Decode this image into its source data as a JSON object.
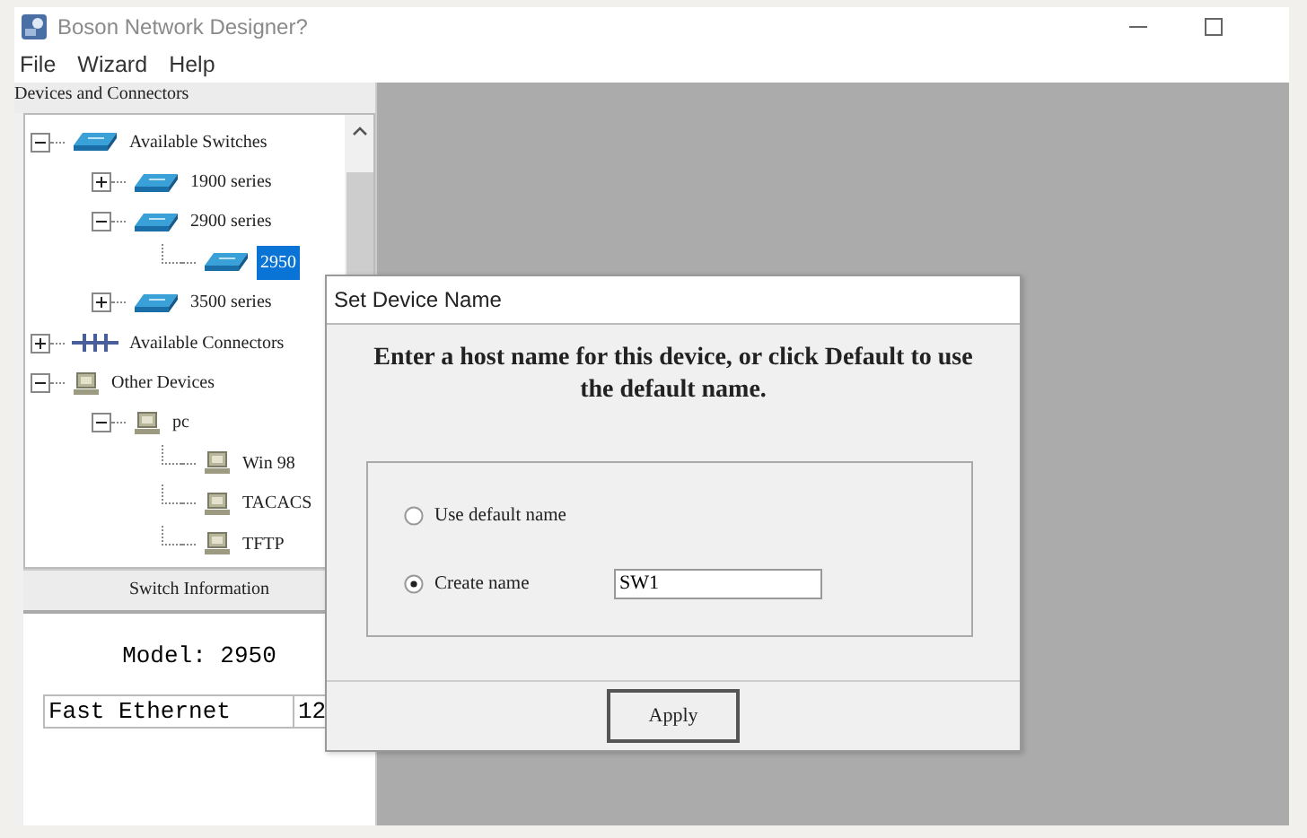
{
  "window": {
    "title": "Boson Network Designer?"
  },
  "menu": [
    "File",
    "Wizard",
    "Help"
  ],
  "devices_panel": {
    "title": "Devices and Connectors",
    "tree": [
      {
        "label": "Available Switches",
        "kind": "switch",
        "expanded": true,
        "selected": false,
        "children": [
          {
            "label": "1900 series",
            "kind": "switch",
            "expanded": false,
            "selected": false
          },
          {
            "label": "2900 series",
            "kind": "switch",
            "expanded": true,
            "selected": false,
            "children": [
              {
                "label": "2950",
                "kind": "switch",
                "selected": true
              }
            ]
          },
          {
            "label": "3500 series",
            "kind": "switch",
            "expanded": false,
            "selected": false
          }
        ]
      },
      {
        "label": "Available Connectors",
        "kind": "connector",
        "expanded": false,
        "selected": false
      },
      {
        "label": "Other Devices",
        "kind": "pc",
        "expanded": true,
        "selected": false,
        "children": [
          {
            "label": "pc",
            "kind": "pc",
            "expanded": true,
            "selected": false,
            "children": [
              {
                "label": "Win 98",
                "kind": "pc",
                "selected": false
              },
              {
                "label": "TACACS",
                "kind": "pc",
                "selected": false
              },
              {
                "label": "TFTP",
                "kind": "pc",
                "selected": false
              }
            ]
          }
        ]
      }
    ]
  },
  "switch_info": {
    "title": "Switch Information",
    "model": "Model: 2950",
    "ports": [
      {
        "name": "Fast Ethernet",
        "count": "12"
      }
    ]
  },
  "dialog": {
    "title": "Set Device Name",
    "prompt": "Enter a host name for this device, or click Default to use the default name.",
    "options": [
      {
        "label": "Use default name",
        "selected": false
      },
      {
        "label": "Create name",
        "selected": true,
        "value": "SW1"
      }
    ],
    "button": "Apply"
  }
}
